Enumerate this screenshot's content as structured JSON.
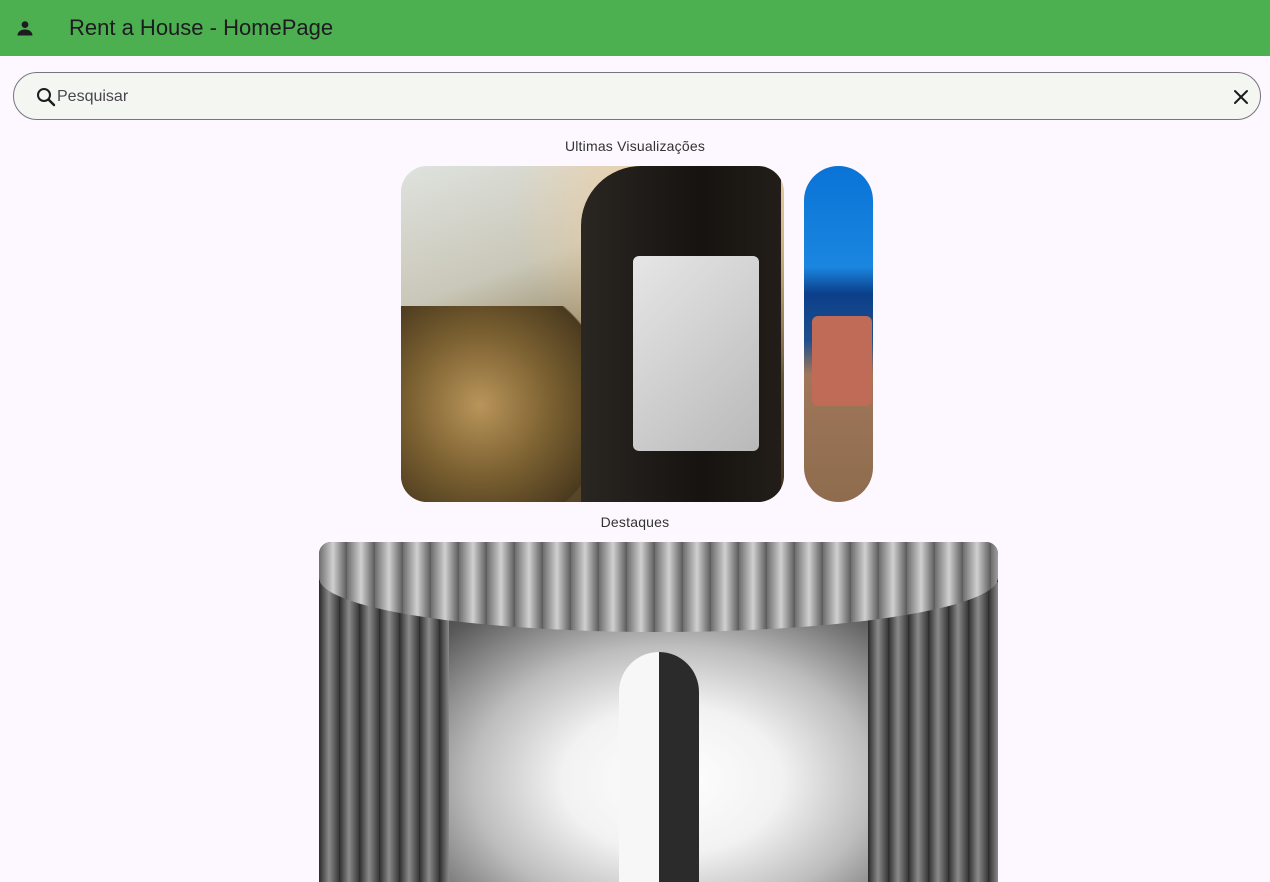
{
  "appbar": {
    "title": "Rent a House - HomePage",
    "profile_icon": "person-icon",
    "color": "#4caf50"
  },
  "search": {
    "placeholder": "Pesquisar",
    "value": "",
    "search_icon": "search-icon",
    "clear_icon": "close-icon"
  },
  "recent": {
    "label": "Ultimas Visualizações",
    "items": [
      {
        "name": "recent-card-1"
      },
      {
        "name": "recent-card-2"
      }
    ]
  },
  "featured": {
    "label": "Destaques",
    "items": [
      {
        "name": "featured-card-1"
      }
    ]
  }
}
